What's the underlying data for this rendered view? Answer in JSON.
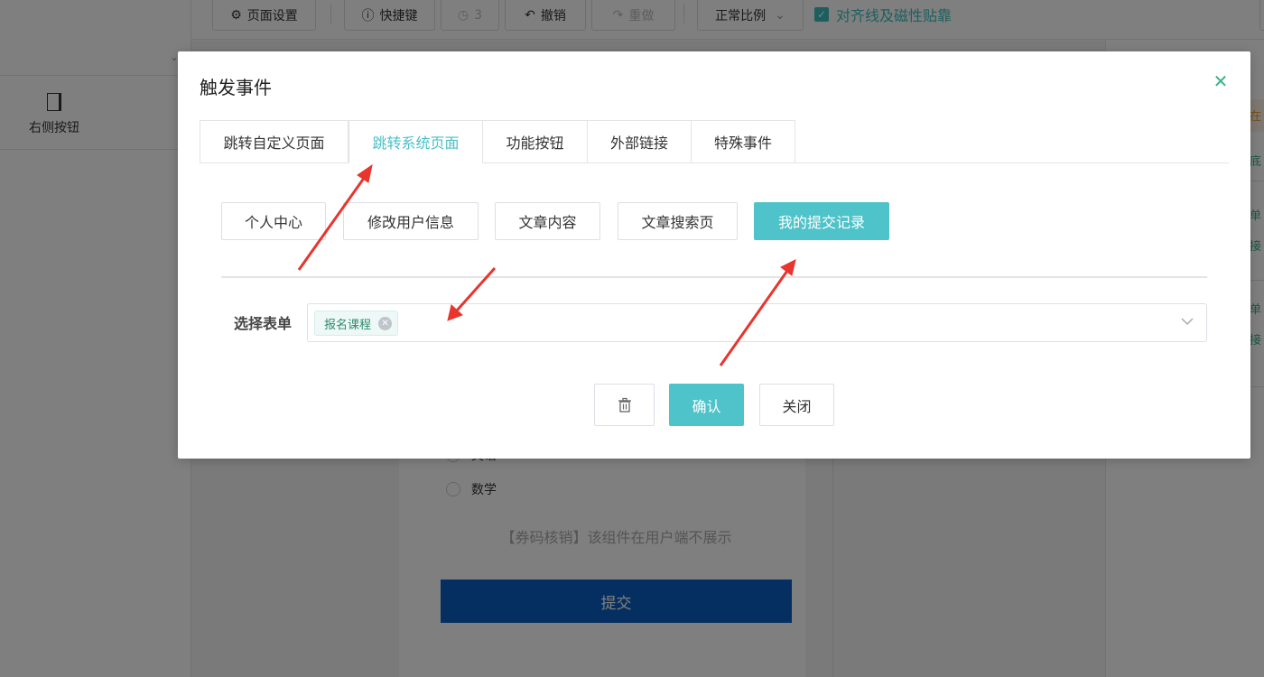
{
  "toolbar": {
    "page_settings": "页面设置",
    "shortcuts": "快捷键",
    "history_count": "3",
    "undo": "撤销",
    "redo": "重做",
    "zoom": "正常比例",
    "snap_label": "对齐线及磁性贴靠"
  },
  "left_panel": {
    "widget_label": "右侧按钮"
  },
  "canvas": {
    "radio_option_partial": "英语",
    "radio_option": "数学",
    "coupon_notice": "【券码核销】该组件在用户端不展示",
    "submit_label": "提交"
  },
  "right_panel": {
    "fragments": [
      "在",
      "底",
      "单",
      "接",
      "单",
      "接"
    ]
  },
  "modal": {
    "title": "触发事件",
    "close_icon": "close-icon",
    "tabs": [
      {
        "label": "跳转自定义页面"
      },
      {
        "label": "跳转系统页面",
        "active": true
      },
      {
        "label": "功能按钮"
      },
      {
        "label": "外部链接"
      },
      {
        "label": "特殊事件"
      }
    ],
    "sub_buttons": [
      {
        "label": "个人中心"
      },
      {
        "label": "修改用户信息"
      },
      {
        "label": "文章内容"
      },
      {
        "label": "文章搜索页"
      },
      {
        "label": "我的提交记录",
        "active": true
      }
    ],
    "form_label": "选择表单",
    "selected_tags": [
      "报名课程"
    ],
    "footer": {
      "delete_icon": "trash-icon",
      "confirm": "确认",
      "close": "关闭"
    }
  },
  "colors": {
    "accent": "#4ec3c9",
    "submit_blue": "#0a5ec3",
    "annotation_red": "#e8352e"
  }
}
